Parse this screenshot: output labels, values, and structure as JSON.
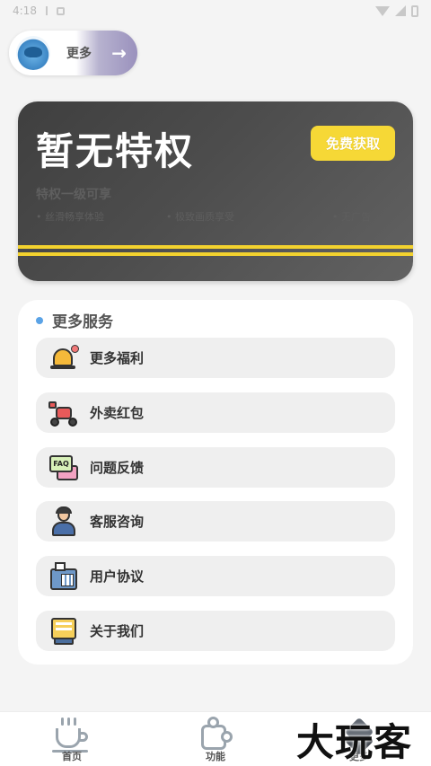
{
  "status_bar": {
    "time": "4:18"
  },
  "header": {
    "more_label": "更多",
    "arrow_glyph": "→"
  },
  "vip_card": {
    "title": "暂无特权",
    "button_label": "免费获取",
    "subtitle": "特权一级可享",
    "features": [
      "丝滑畅享体验",
      "极致画质享受",
      "无广告"
    ]
  },
  "services": {
    "title": "更多服务",
    "items": [
      {
        "label": "更多福利",
        "icon": "bell-icon"
      },
      {
        "label": "外卖红包",
        "icon": "scooter-icon"
      },
      {
        "label": "问题反馈",
        "icon": "faq-icon",
        "icon_text": "FAQ"
      },
      {
        "label": "客服咨询",
        "icon": "customer-service-icon"
      },
      {
        "label": "用户协议",
        "icon": "fax-phone-icon"
      },
      {
        "label": "关于我们",
        "icon": "info-box-icon"
      }
    ]
  },
  "bottom_nav": {
    "items": [
      {
        "label": "首页",
        "icon": "coffee-cup-icon"
      },
      {
        "label": "功能",
        "icon": "puzzle-icon"
      },
      {
        "label": "更多",
        "icon": "layers-icon",
        "active": true
      }
    ]
  },
  "watermark": "大玩客",
  "colors": {
    "accent_yellow": "#f6d836",
    "dot_blue": "#5aa3e6",
    "card_dark": "#4d4d4d"
  }
}
